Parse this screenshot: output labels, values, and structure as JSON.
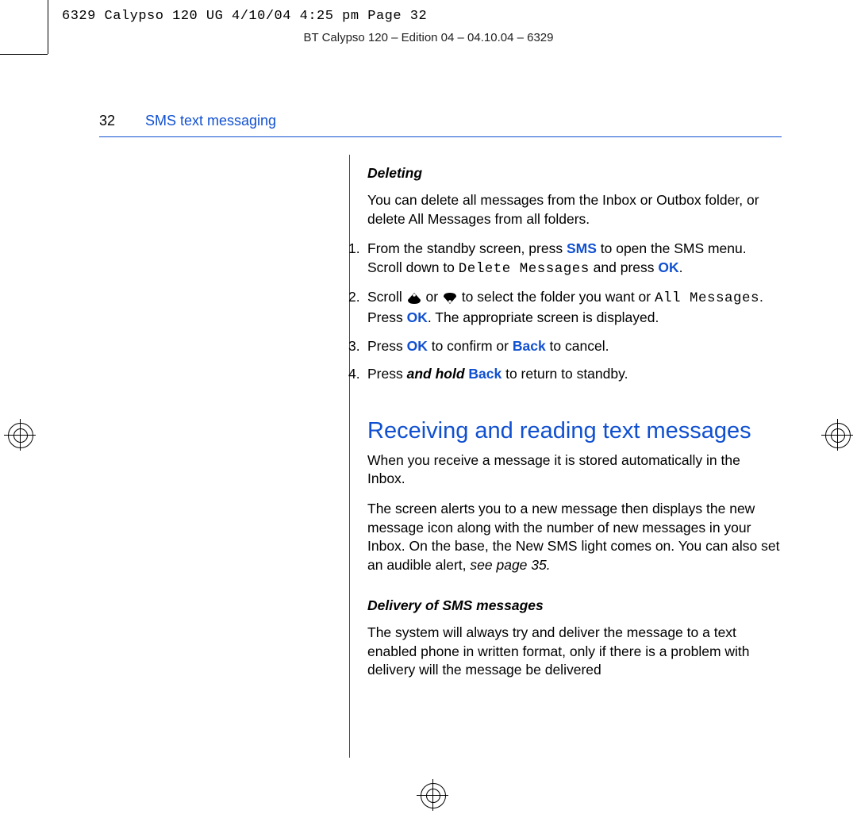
{
  "meta_line": "6329 Calypso 120 UG   4/10/04  4:25 pm  Page 32",
  "edition_line": "BT Calypso 120 – Edition 04 – 04.10.04 – 6329",
  "page_number": "32",
  "section_title": "SMS text messaging",
  "deleting": {
    "title": "Deleting",
    "intro": "You can delete all messages from the Inbox or Outbox folder, or delete All Messages from all folders.",
    "steps": [
      {
        "n": "1.",
        "pre": "From the standby screen, press ",
        "sms": "SMS",
        "mid": " to open the SMS menu. Scroll down to ",
        "mono": "Delete Messages",
        "mid2": " and press ",
        "ok": "OK",
        "post": "."
      },
      {
        "n": "2.",
        "pre": "Scroll ",
        "mid_or": " or ",
        "mid": " to select the folder you want or ",
        "mono": "All Messages",
        "mid2": ". Press ",
        "ok": "OK",
        "post": ". The appropriate screen is displayed."
      },
      {
        "n": "3.",
        "pre": "Press ",
        "ok": "OK",
        "mid": " to confirm or ",
        "back": "Back",
        "post": " to cancel."
      },
      {
        "n": "4.",
        "pre": "Press ",
        "hold": "and hold",
        "back": " Back",
        "post": " to return to standby."
      }
    ]
  },
  "receiving": {
    "title": "Receiving and reading text messages",
    "p1": "When you receive a message it is stored automatically in the Inbox.",
    "p2_pre": "The screen alerts you to a new message then displays the new message icon along with the number of new messages in your Inbox. On the base, the New SMS light comes on. You can also set an audible alert, ",
    "p2_em": "see page 35.",
    "delivery_title": "Delivery of SMS messages",
    "p3": "The system will always try and deliver the message to a text enabled phone in written format, only if there is a problem with delivery will the message be delivered"
  }
}
